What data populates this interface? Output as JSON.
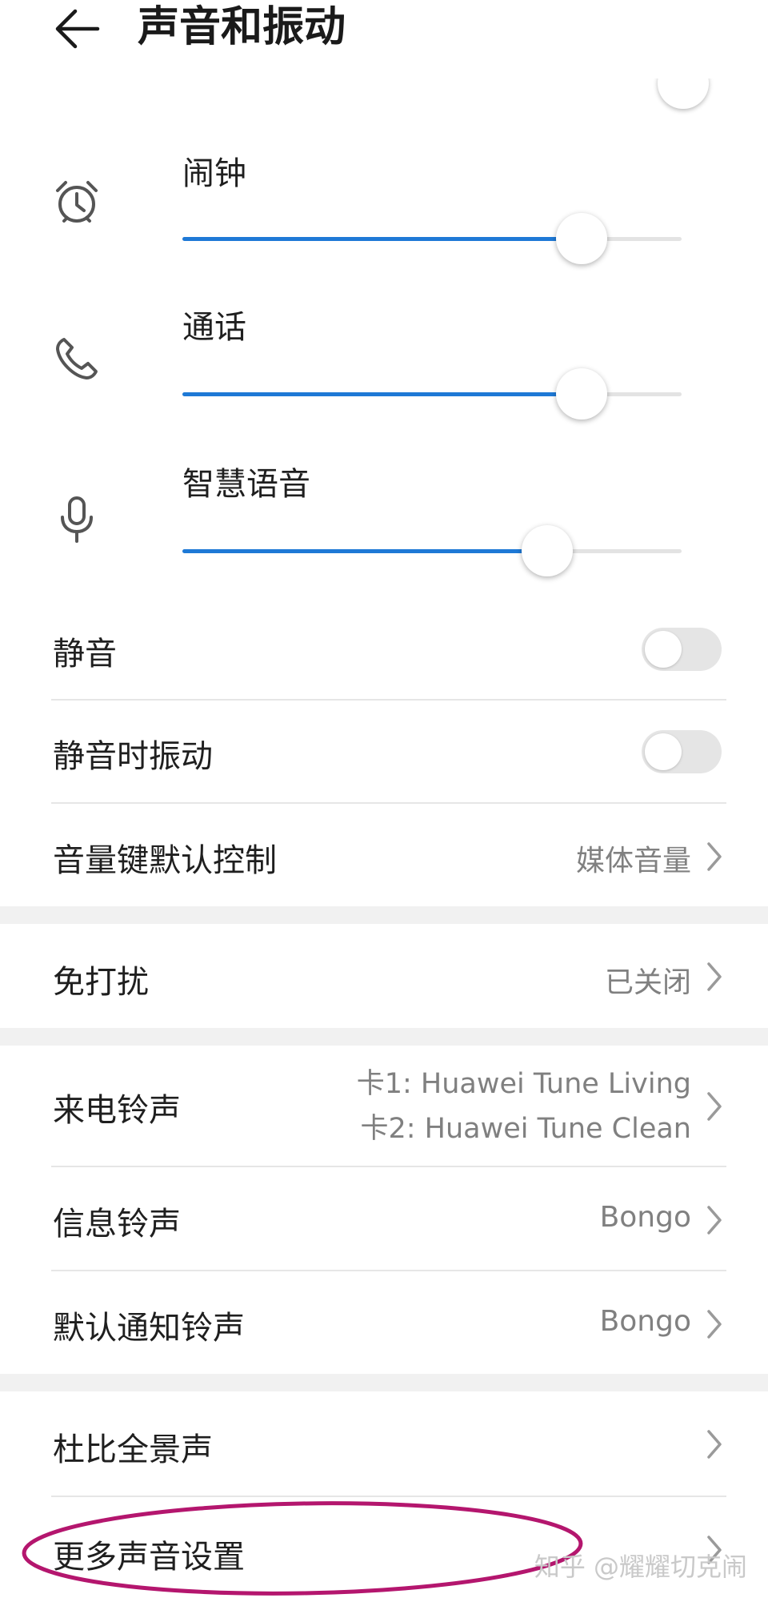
{
  "header": {
    "title": "声音和振动"
  },
  "volumes": [
    {
      "name": "alarm",
      "icon": "alarm-clock-icon",
      "label": "闹钟",
      "level": 0.8
    },
    {
      "name": "call",
      "icon": "phone-icon",
      "label": "通话",
      "level": 0.8
    },
    {
      "name": "voice-assistant",
      "icon": "microphone-icon",
      "label": "智慧语音",
      "level": 0.73
    }
  ],
  "settings": {
    "silent": {
      "label": "静音",
      "on": false
    },
    "vibrate_when_silent": {
      "label": "静音时振动",
      "on": false
    },
    "volume_key_default": {
      "label": "音量键默认控制",
      "value": "媒体音量"
    },
    "do_not_disturb": {
      "label": "免打扰",
      "value": "已关闭"
    },
    "ringtone": {
      "label": "来电铃声",
      "value_sim1": "卡1: Huawei Tune Living",
      "value_sim2": "卡2: Huawei Tune Clean"
    },
    "message_tone": {
      "label": "信息铃声",
      "value": "Bongo"
    },
    "notification_tone": {
      "label": "默认通知铃声",
      "value": "Bongo"
    },
    "dolby_atmos": {
      "label": "杜比全景声"
    },
    "more_sound_settings": {
      "label": "更多声音设置"
    }
  },
  "colors": {
    "accent": "#1e79d6",
    "annotation": "#b4166e"
  },
  "watermark": "知乎 @耀耀切克闹"
}
